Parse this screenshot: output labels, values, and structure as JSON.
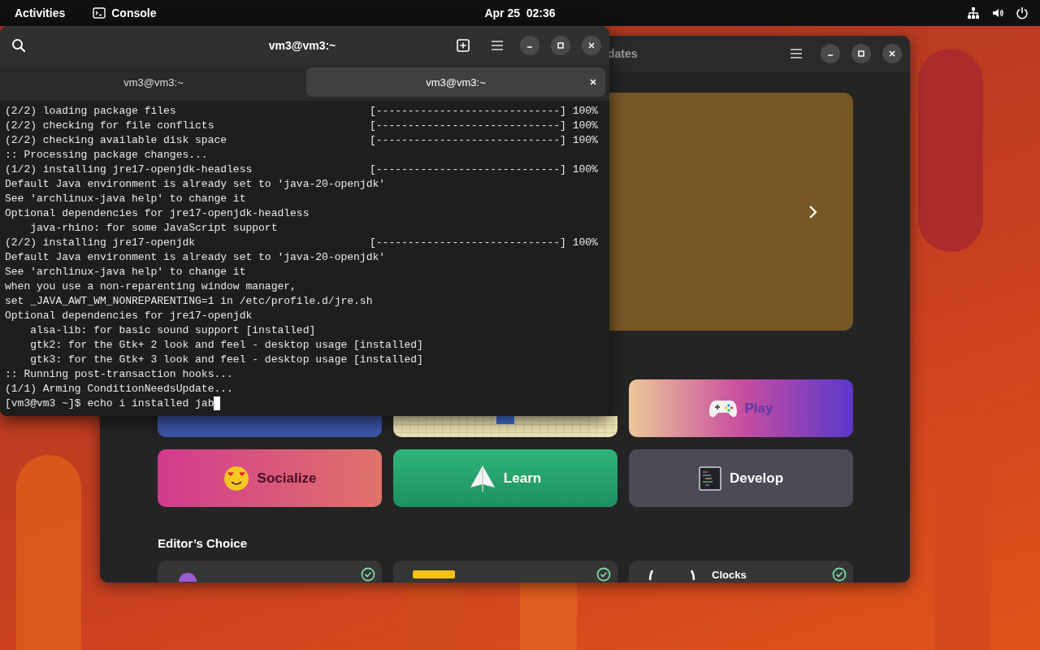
{
  "top_bar": {
    "activities": "Activities",
    "app": "Console",
    "clock": "Apr 25  02:36"
  },
  "software_window": {
    "title": "dates",
    "categories": [
      {
        "kind": "covered-blue"
      },
      {
        "kind": "grid-paper"
      },
      {
        "kind": "gamepad",
        "label": "Play"
      },
      {
        "kind": "smiley",
        "label": "Socialize"
      },
      {
        "kind": "paper-plane",
        "label": "Learn"
      },
      {
        "kind": "code",
        "label": "Develop"
      }
    ],
    "editors_choice": {
      "heading": "Editor’s Choice",
      "apps": [
        {
          "kind": "purple",
          "installed": true
        },
        {
          "kind": "folder",
          "installed": true
        },
        {
          "kind": "clock",
          "name": "Clocks",
          "installed": true
        }
      ]
    }
  },
  "terminal": {
    "title": "vm3@vm3:~",
    "tabs": [
      {
        "label": "vm3@vm3:~",
        "selected": false
      },
      {
        "label": "vm3@vm3:~",
        "selected": true
      }
    ],
    "lines": [
      {
        "text": "(2/2) loading package files",
        "progress": "[-----------------------------] 100%"
      },
      {
        "text": "(2/2) checking for file conflicts",
        "progress": "[-----------------------------] 100%"
      },
      {
        "text": "(2/2) checking available disk space",
        "progress": "[-----------------------------] 100%"
      },
      {
        "text": ":: Processing package changes..."
      },
      {
        "text": "(1/2) installing jre17-openjdk-headless",
        "progress": "[-----------------------------] 100%"
      },
      {
        "text": "Default Java environment is already set to 'java-20-openjdk'"
      },
      {
        "text": "See 'archlinux-java help' to change it"
      },
      {
        "text": "Optional dependencies for jre17-openjdk-headless"
      },
      {
        "text": "    java-rhino: for some JavaScript support"
      },
      {
        "text": "(2/2) installing jre17-openjdk",
        "progress": "[-----------------------------] 100%"
      },
      {
        "text": "Default Java environment is already set to 'java-20-openjdk'"
      },
      {
        "text": "See 'archlinux-java help' to change it"
      },
      {
        "text": "when you use a non-reparenting window manager,"
      },
      {
        "text": "set _JAVA_AWT_WM_NONREPARENTING=1 in /etc/profile.d/jre.sh"
      },
      {
        "text": "Optional dependencies for jre17-openjdk"
      },
      {
        "text": "    alsa-lib: for basic sound support [installed]"
      },
      {
        "text": "    gtk2: for the Gtk+ 2 look and feel - desktop usage [installed]"
      },
      {
        "text": "    gtk3: for the Gtk+ 3 look and feel - desktop usage [installed]"
      },
      {
        "text": ":: Running post-transaction hooks..."
      },
      {
        "text": "(1/1) Arming ConditionNeedsUpdate..."
      }
    ],
    "prompt": {
      "text": "[vm3@vm3 ~]$ echo i installed jab",
      "cursor": true
    }
  }
}
